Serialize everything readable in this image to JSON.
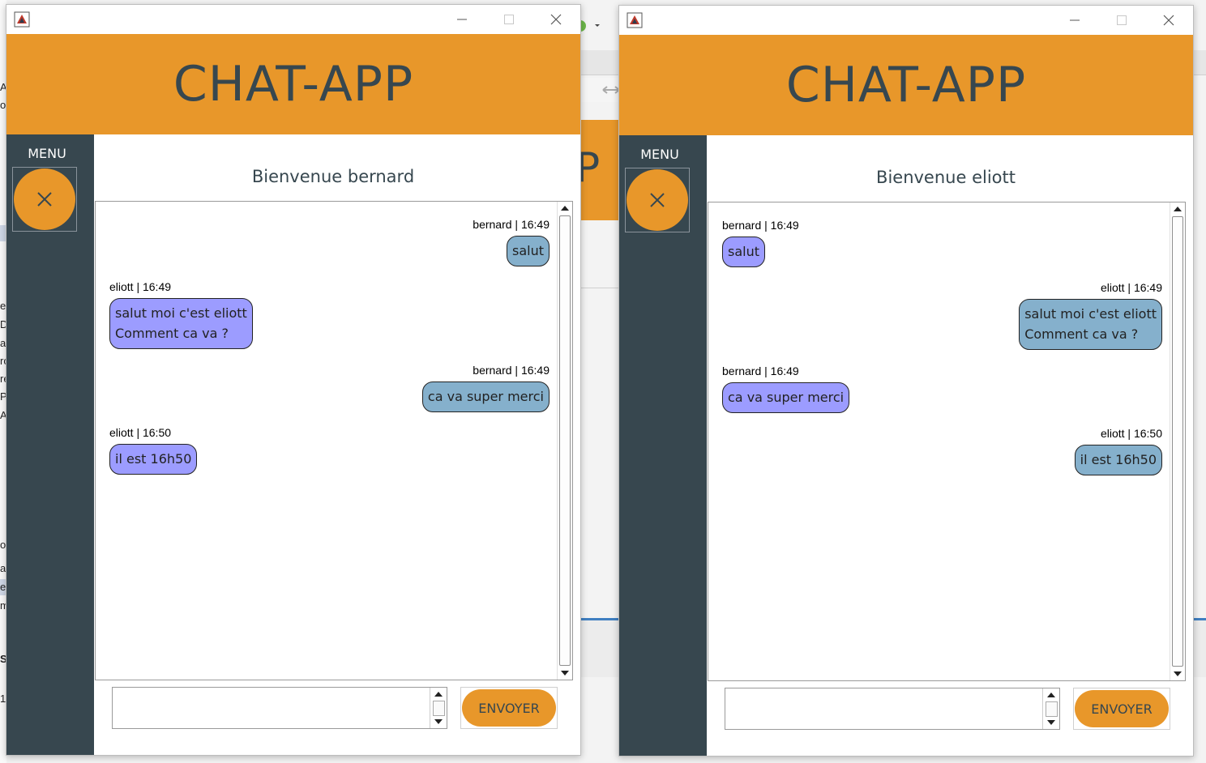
{
  "background_fragments": {
    "header_fragment": "P",
    "left_edge_letters": [
      "A",
      "o",
      "e",
      "De",
      "av",
      "ro",
      "re",
      "Pr",
      "A",
      "o",
      "ai",
      "er",
      "m",
      "S",
      "1"
    ]
  },
  "windows": [
    {
      "id": "left",
      "app_title": "CHAT-APP",
      "menu_label": "MENU",
      "welcome": "Bienvenue bernard",
      "input_value": "",
      "send_label": "ENVOYER",
      "messages": [
        {
          "author": "bernard",
          "time": "16:49",
          "meta": "bernard | 16:49",
          "lines": [
            "salut"
          ],
          "side": "right",
          "color": "blue"
        },
        {
          "author": "eliott",
          "time": "16:49",
          "meta": "eliott | 16:49",
          "lines": [
            "salut moi c'est eliott",
            "Comment ca va ?"
          ],
          "side": "left",
          "color": "purple"
        },
        {
          "author": "bernard",
          "time": "16:49",
          "meta": "bernard | 16:49",
          "lines": [
            "ca va super merci"
          ],
          "side": "right",
          "color": "blue"
        },
        {
          "author": "eliott",
          "time": "16:50",
          "meta": "eliott | 16:50",
          "lines": [
            "il est 16h50"
          ],
          "side": "left",
          "color": "purple"
        }
      ]
    },
    {
      "id": "right",
      "app_title": "CHAT-APP",
      "menu_label": "MENU",
      "welcome": "Bienvenue eliott",
      "input_value": "",
      "send_label": "ENVOYER",
      "messages": [
        {
          "author": "bernard",
          "time": "16:49",
          "meta": "bernard | 16:49",
          "lines": [
            "salut"
          ],
          "side": "left",
          "color": "purple"
        },
        {
          "author": "eliott",
          "time": "16:49",
          "meta": "eliott | 16:49",
          "lines": [
            "salut moi c'est eliott",
            "Comment ca va ?"
          ],
          "side": "right",
          "color": "blue"
        },
        {
          "author": "bernard",
          "time": "16:49",
          "meta": "bernard | 16:49",
          "lines": [
            "ca va super merci"
          ],
          "side": "left",
          "color": "purple"
        },
        {
          "author": "eliott",
          "time": "16:50",
          "meta": "eliott | 16:50",
          "lines": [
            "il est 16h50"
          ],
          "side": "right",
          "color": "blue"
        }
      ]
    }
  ],
  "colors": {
    "header_orange": "#e8972a",
    "sidebar_slate": "#37474f",
    "bubble_purple": "#9c9cff",
    "bubble_blue": "#85b0cc"
  },
  "icons": {
    "window_controls": [
      "minimize-icon",
      "maximize-icon",
      "close-icon"
    ],
    "menu_button": "close-x-icon",
    "app": "java-app-icon"
  }
}
